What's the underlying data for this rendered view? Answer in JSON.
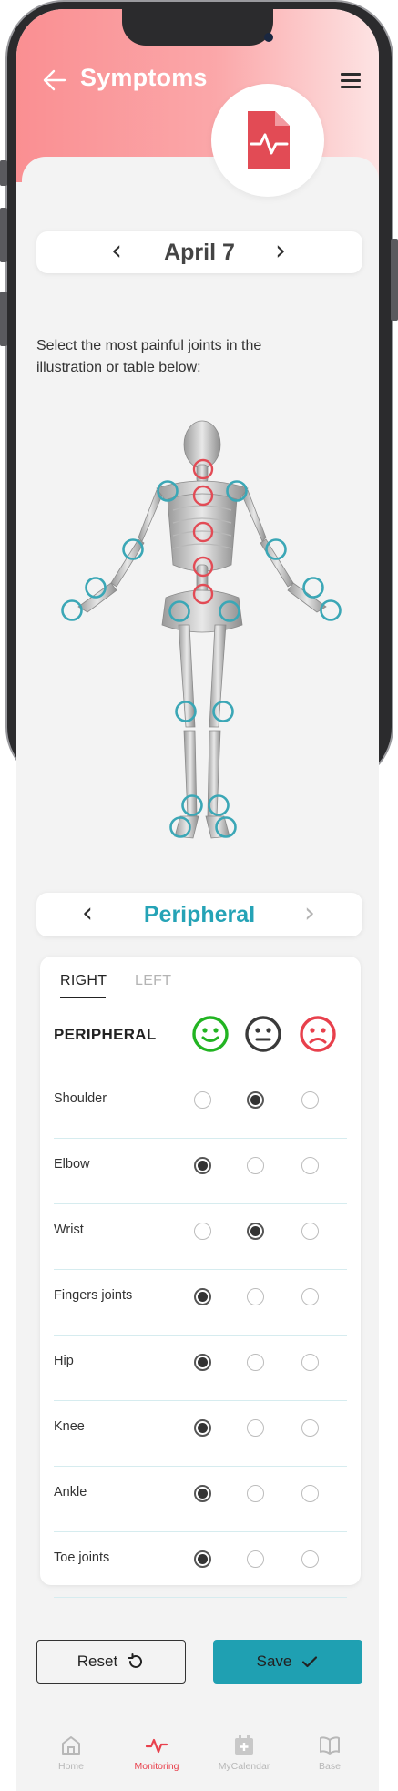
{
  "header": {
    "title": "Symptoms"
  },
  "date_selector": {
    "label": "April 7",
    "prev": "‹",
    "next": "›"
  },
  "instruction": "Select the most painful joints in the illustration or table below:",
  "group_selector": {
    "label": "Peripheral",
    "prev": "‹",
    "next": "›"
  },
  "tabs": [
    {
      "label": "RIGHT",
      "active": true
    },
    {
      "label": "LEFT",
      "active": false
    }
  ],
  "table": {
    "header": "PERIPHERAL",
    "columns": [
      {
        "icon": "happy-face-icon",
        "color": "#22b422"
      },
      {
        "icon": "neutral-face-icon",
        "color": "#3a3a3a"
      },
      {
        "icon": "sad-face-icon",
        "color": "#e8404c"
      }
    ],
    "rows": [
      {
        "label": "Shoulder",
        "selected": 1
      },
      {
        "label": "Elbow",
        "selected": 0
      },
      {
        "label": "Wrist",
        "selected": 1
      },
      {
        "label": "Fingers joints",
        "selected": 0
      },
      {
        "label": "Hip",
        "selected": 0
      },
      {
        "label": "Knee",
        "selected": 0
      },
      {
        "label": "Ankle",
        "selected": 0
      },
      {
        "label": "Toe joints",
        "selected": 0
      }
    ]
  },
  "buttons": {
    "reset": "Reset",
    "save": "Save"
  },
  "nav": [
    {
      "label": "Home",
      "icon": "home-icon",
      "active": false
    },
    {
      "label": "Monitoring",
      "icon": "pulse-icon",
      "active": true
    },
    {
      "label": "MyCalendar",
      "icon": "calendar-plus-icon",
      "active": false
    },
    {
      "label": "Base",
      "icon": "book-icon",
      "active": false
    }
  ],
  "colors": {
    "accent_teal": "#1fa0b2",
    "accent_red": "#e8404c",
    "joint_marker_teal": "#3ba7b6",
    "joint_marker_red": "#e24b55",
    "header_pink": "#fa8f92"
  }
}
